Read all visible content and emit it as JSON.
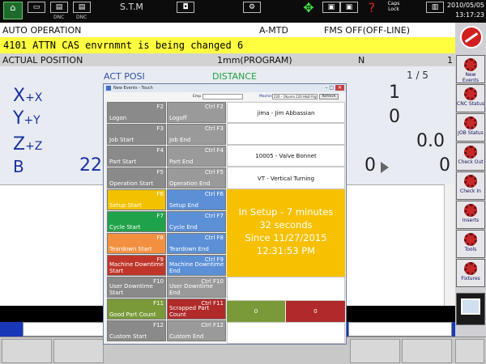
{
  "topbar": {
    "app_title": "S.T.M",
    "caps_label": "Caps\nLock",
    "date": "2010/05/05",
    "time": "13:17:23",
    "small_labels": [
      "DNC",
      "DNC"
    ]
  },
  "mode": {
    "operation": "AUTO OPERATION",
    "mode": "A-MTD",
    "fms": "FMS OFF(OFF-LINE)"
  },
  "alarm": {
    "message": "4101 ATTN CAS envrnmnt is being changed 6"
  },
  "position": {
    "title": "ACTUAL POSITION",
    "program": "1mm(PROGRAM)",
    "n_label": "N",
    "n_value": "1"
  },
  "main": {
    "col_posi": "ACT POSI",
    "col_distance": "DISTANCE",
    "page": "1 / 5",
    "axes": [
      {
        "name": "X",
        "sub": "+X"
      },
      {
        "name": "Y",
        "sub": "+Y"
      },
      {
        "name": "Z",
        "sub": "+Z"
      },
      {
        "name": "B",
        "sub": ""
      }
    ],
    "b_value": "22",
    "right_values": [
      "1",
      "0",
      "0.0",
      "0",
      "0"
    ]
  },
  "side_buttons": [
    {
      "label": "New Events"
    },
    {
      "label": "CNC Status"
    },
    {
      "label": "JOB Status"
    },
    {
      "label": "Check Out"
    },
    {
      "label": "Check In"
    },
    {
      "label": "Inserts"
    },
    {
      "label": "Tools"
    },
    {
      "label": "Fixtures"
    }
  ],
  "dialog": {
    "title": "New Events - Touch",
    "employee_label": "Emp",
    "employee_value": "",
    "machine_label": "Machine",
    "machine_value": "226 - Okuma 226 H&B Right",
    "refresh_label": "Refresh",
    "buttons": [
      {
        "key": "F2",
        "name": "Logon",
        "color": "#8a8a8a"
      },
      {
        "key": "Ctrl F2",
        "name": "Logoff",
        "color": "#9a9a9a"
      },
      {
        "key": "F3",
        "name": "Job Start",
        "color": "#8a8a8a"
      },
      {
        "key": "Ctrl F3",
        "name": "Job End",
        "color": "#9a9a9a"
      },
      {
        "key": "F4",
        "name": "Part Start",
        "color": "#8a8a8a"
      },
      {
        "key": "Ctrl F4",
        "name": "Part End",
        "color": "#9a9a9a"
      },
      {
        "key": "F5",
        "name": "Operation Start",
        "color": "#8a8a8a"
      },
      {
        "key": "Ctrl F5",
        "name": "Operation End",
        "color": "#9a9a9a"
      },
      {
        "key": "F6",
        "name": "Setup Start",
        "color": "#f2c200"
      },
      {
        "key": "Ctrl F6",
        "name": "Setup End",
        "color": "#5b8fd6"
      },
      {
        "key": "F7",
        "name": "Cycle Start",
        "color": "#1fa34a"
      },
      {
        "key": "Ctrl F7",
        "name": "Cycle End",
        "color": "#5b8fd6"
      },
      {
        "key": "F8",
        "name": "Teardown Start",
        "color": "#f39040"
      },
      {
        "key": "Ctrl F8",
        "name": "Teardown End",
        "color": "#5b8fd6"
      },
      {
        "key": "F9",
        "name": "Machine Downtime\nStart",
        "color": "#c0352a"
      },
      {
        "key": "Ctrl F9",
        "name": "Machine Downtime\nEnd",
        "color": "#5b8fd6"
      },
      {
        "key": "F10",
        "name": "User Downtime Start",
        "color": "#8a8a8a"
      },
      {
        "key": "Ctrl F10",
        "name": "User Downtime End",
        "color": "#9a9a9a"
      },
      {
        "key": "F11",
        "name": "Good Part Count",
        "color": "#7a9a3a"
      },
      {
        "key": "Ctrl F11",
        "name": "Scrapped Part Count",
        "color": "#b02a2a"
      },
      {
        "key": "F12",
        "name": "Custom Start",
        "color": "#8a8a8a"
      },
      {
        "key": "Ctrl F12",
        "name": "Custom End",
        "color": "#9a9a9a"
      }
    ],
    "info": {
      "employee": "jima - Jim Abbassian",
      "part": "10005 - Valve Bonnet",
      "operation": "VT - Vertical Turning"
    },
    "status": {
      "line1": "In Setup -  7 minutes",
      "line2": "32 seconds",
      "line3": "Since 11/27/2015",
      "line4": "12:31:53 PM",
      "color": "#f7c000"
    },
    "counts": {
      "good": "0",
      "scrap": "0",
      "good_color": "#7a9a3a",
      "scrap_color": "#b02a2a"
    }
  }
}
